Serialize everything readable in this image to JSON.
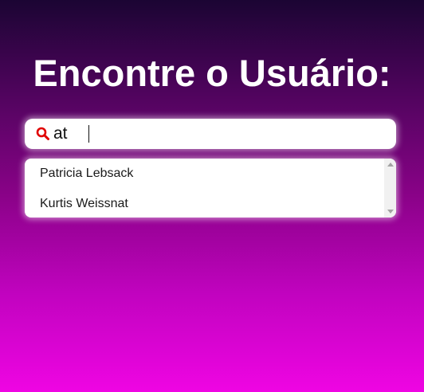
{
  "page": {
    "title": "Encontre o Usuário:"
  },
  "search": {
    "value": "at",
    "icon": "search-icon",
    "icon_color": "#e00000"
  },
  "results": {
    "items": [
      {
        "label": "Patricia Lebsack"
      },
      {
        "label": "Kurtis Weissnat"
      }
    ]
  },
  "colors": {
    "gradient_top": "#1b0533",
    "gradient_bottom": "#ef05e3",
    "text_light": "#ffffff"
  }
}
